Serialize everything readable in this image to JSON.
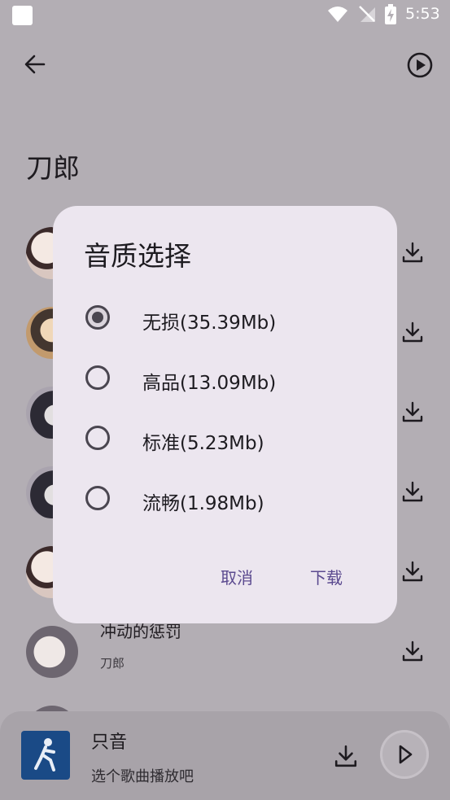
{
  "status": {
    "time": "5:53"
  },
  "header": {
    "page_title": "刀郎"
  },
  "list": {
    "items": [
      {
        "title": "",
        "artist": ""
      },
      {
        "title": "",
        "artist": ""
      },
      {
        "title": "",
        "artist": ""
      },
      {
        "title": "",
        "artist": ""
      },
      {
        "title": "",
        "artist": ""
      },
      {
        "title": "冲动的惩罚",
        "artist": "刀郎"
      }
    ]
  },
  "player": {
    "title": "只音",
    "subtitle": "选个歌曲播放吧"
  },
  "dialog": {
    "title": "音质选择",
    "options": [
      {
        "label": "无损(35.39Mb)",
        "selected": true
      },
      {
        "label": "高品(13.09Mb)",
        "selected": false
      },
      {
        "label": "标准(5.23Mb)",
        "selected": false
      },
      {
        "label": "流畅(1.98Mb)",
        "selected": false
      }
    ],
    "cancel_label": "取消",
    "confirm_label": "下载"
  }
}
